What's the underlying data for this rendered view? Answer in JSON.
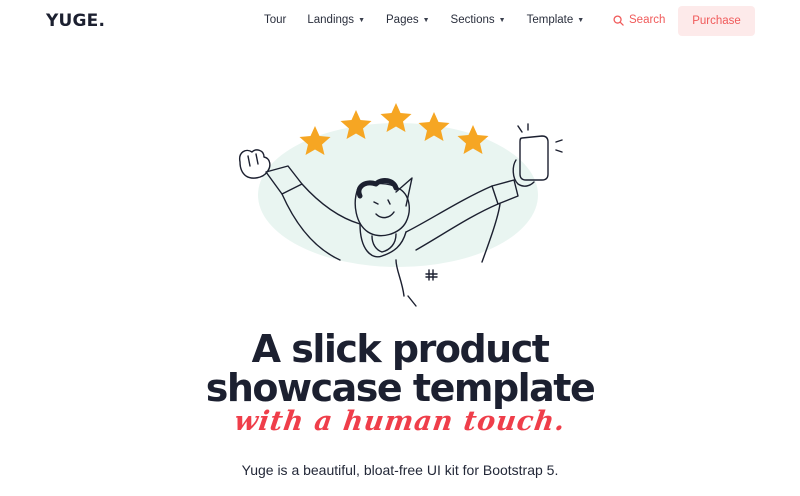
{
  "brand": {
    "logo_text": "YUGE."
  },
  "nav": {
    "items": [
      {
        "label": "Tour",
        "has_dropdown": false
      },
      {
        "label": "Landings",
        "has_dropdown": true
      },
      {
        "label": "Pages",
        "has_dropdown": true
      },
      {
        "label": "Sections",
        "has_dropdown": true
      },
      {
        "label": "Template",
        "has_dropdown": true
      }
    ],
    "search_label": "Search",
    "purchase_label": "Purchase"
  },
  "hero": {
    "headline_line1": "A slick product",
    "headline_line2": "showcase template",
    "script_line": "with a human touch.",
    "subtext": "Yuge is a beautiful, bloat-free UI kit for Bootstrap 5."
  },
  "colors": {
    "accent": "#f05a5a",
    "accent_bg": "#fdeaea",
    "star": "#f6a623",
    "blob": "#e9f5f1",
    "text_dark": "#1c2030"
  },
  "icons": {
    "search": "search-icon",
    "caret": "caret-down-icon"
  }
}
